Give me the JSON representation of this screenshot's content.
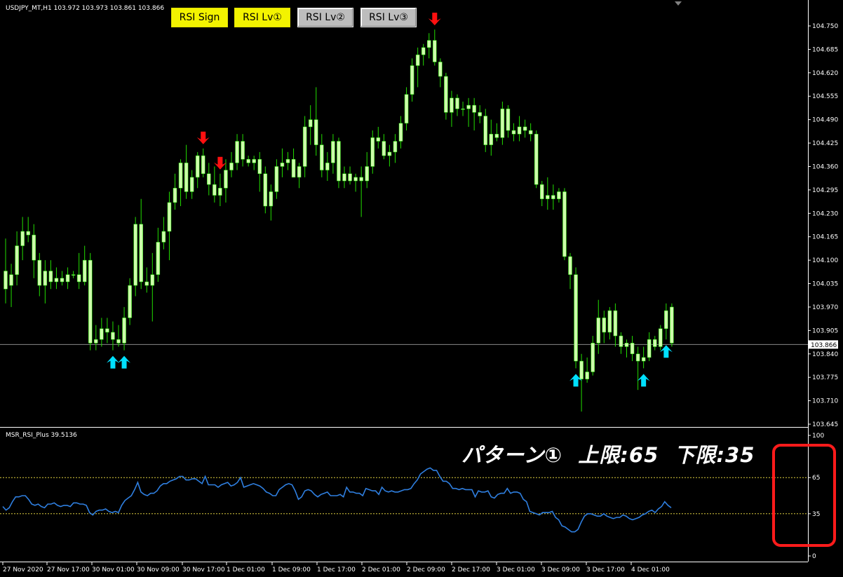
{
  "chart_header": {
    "symbol_line": "USDJPY_MT,H1  103.972 103.973 103.861 103.866"
  },
  "buttons": [
    {
      "label": "RSI Sign",
      "state": "on"
    },
    {
      "label": "RSI Lv①",
      "state": "on"
    },
    {
      "label": "RSI Lv②",
      "state": "off"
    },
    {
      "label": "RSI Lv③",
      "state": "off"
    }
  ],
  "indicator": {
    "label": "MSR_RSI_Plus 39.5136",
    "pattern_title": "パターン①  上限:65  下限:35",
    "upper_level": 65,
    "lower_level": 35
  },
  "price_axis": {
    "ticks": [
      "104.750",
      "104.685",
      "104.620",
      "104.555",
      "104.490",
      "104.425",
      "104.360",
      "104.295",
      "104.230",
      "104.165",
      "104.100",
      "104.035",
      "103.970",
      "103.905",
      "103.840",
      "103.775",
      "103.710",
      "103.645"
    ],
    "current_price": "103.866"
  },
  "rsi_axis": {
    "ticks": [
      "100",
      "65",
      "35",
      "0"
    ]
  },
  "time_axis": {
    "labels": [
      "27 Nov 2020",
      "27 Nov 17:00",
      "30 Nov 01:00",
      "30 Nov 09:00",
      "30 Nov 17:00",
      "1 Dec 01:00",
      "1 Dec 09:00",
      "1 Dec 17:00",
      "2 Dec 01:00",
      "2 Dec 09:00",
      "2 Dec 17:00",
      "3 Dec 01:00",
      "3 Dec 09:00",
      "3 Dec 17:00",
      "4 Dec 01:00"
    ]
  },
  "colors": {
    "background": "#000000",
    "candle_up": "#ccffaa",
    "candle_down": "#ccffaa",
    "wick": "#22dd00",
    "rsi_line": "#2f7fe0",
    "level_line": "#e0d040",
    "buy_arrow": "#00e0ff",
    "sell_arrow": "#ff1010",
    "button_on": "#f3f300",
    "button_off": "#bdbdbd",
    "highlight": "#ff1b1b"
  },
  "chart_data": [
    {
      "type": "candlestick",
      "title": "USDJPY_MT,H1",
      "ylim": [
        103.645,
        104.75
      ],
      "x_labels": [
        "27 Nov 2020",
        "27 Nov 17:00",
        "30 Nov 01:00",
        "30 Nov 09:00",
        "30 Nov 17:00",
        "1 Dec 01:00",
        "1 Dec 09:00",
        "1 Dec 17:00",
        "2 Dec 01:00",
        "2 Dec 09:00",
        "2 Dec 17:00",
        "3 Dec 01:00",
        "3 Dec 09:00",
        "3 Dec 17:00",
        "4 Dec 01:00"
      ],
      "candles": [
        {
          "o": 104.07,
          "h": 104.16,
          "l": 103.98,
          "c": 104.02
        },
        {
          "o": 104.03,
          "h": 104.09,
          "l": 103.97,
          "c": 104.06
        },
        {
          "o": 104.06,
          "h": 104.18,
          "l": 104.03,
          "c": 104.14
        },
        {
          "o": 104.14,
          "h": 104.22,
          "l": 104.1,
          "c": 104.18
        },
        {
          "o": 104.18,
          "h": 104.22,
          "l": 104.15,
          "c": 104.17
        },
        {
          "o": 104.17,
          "h": 104.2,
          "l": 104.05,
          "c": 104.1
        },
        {
          "o": 104.1,
          "h": 104.12,
          "l": 104.0,
          "c": 104.03
        },
        {
          "o": 104.03,
          "h": 104.1,
          "l": 103.98,
          "c": 104.07
        },
        {
          "o": 104.07,
          "h": 104.1,
          "l": 104.02,
          "c": 104.04
        },
        {
          "o": 104.04,
          "h": 104.08,
          "l": 104.02,
          "c": 104.05
        },
        {
          "o": 104.05,
          "h": 104.07,
          "l": 104.03,
          "c": 104.04
        },
        {
          "o": 104.04,
          "h": 104.08,
          "l": 104.02,
          "c": 104.06
        },
        {
          "o": 104.06,
          "h": 104.07,
          "l": 104.05,
          "c": 104.06
        },
        {
          "o": 104.06,
          "h": 104.12,
          "l": 104.02,
          "c": 104.04
        },
        {
          "o": 104.04,
          "h": 104.14,
          "l": 104.03,
          "c": 104.1
        },
        {
          "o": 104.1,
          "h": 104.12,
          "l": 103.85,
          "c": 103.87
        },
        {
          "o": 103.87,
          "h": 103.92,
          "l": 103.85,
          "c": 103.88
        },
        {
          "o": 103.88,
          "h": 103.94,
          "l": 103.86,
          "c": 103.91
        },
        {
          "o": 103.91,
          "h": 103.94,
          "l": 103.87,
          "c": 103.9
        },
        {
          "o": 103.9,
          "h": 103.93,
          "l": 103.85,
          "c": 103.88
        },
        {
          "o": 103.88,
          "h": 103.92,
          "l": 103.86,
          "c": 103.87
        },
        {
          "o": 103.87,
          "h": 103.97,
          "l": 103.85,
          "c": 103.94
        },
        {
          "o": 103.94,
          "h": 104.05,
          "l": 103.92,
          "c": 104.03
        },
        {
          "o": 104.03,
          "h": 104.22,
          "l": 104.0,
          "c": 104.2
        },
        {
          "o": 104.2,
          "h": 104.27,
          "l": 104.02,
          "c": 104.04
        },
        {
          "o": 104.04,
          "h": 104.08,
          "l": 104.01,
          "c": 104.03
        },
        {
          "o": 104.03,
          "h": 104.12,
          "l": 103.93,
          "c": 104.06
        },
        {
          "o": 104.06,
          "h": 104.19,
          "l": 104.04,
          "c": 104.15
        },
        {
          "o": 104.15,
          "h": 104.22,
          "l": 104.13,
          "c": 104.18
        },
        {
          "o": 104.18,
          "h": 104.29,
          "l": 104.1,
          "c": 104.26
        },
        {
          "o": 104.26,
          "h": 104.34,
          "l": 104.24,
          "c": 104.3
        },
        {
          "o": 104.3,
          "h": 104.38,
          "l": 104.25,
          "c": 104.37
        },
        {
          "o": 104.37,
          "h": 104.42,
          "l": 104.27,
          "c": 104.29
        },
        {
          "o": 104.29,
          "h": 104.35,
          "l": 104.27,
          "c": 104.33
        },
        {
          "o": 104.33,
          "h": 104.4,
          "l": 104.3,
          "c": 104.39
        },
        {
          "o": 104.39,
          "h": 104.41,
          "l": 104.33,
          "c": 104.34
        },
        {
          "o": 104.34,
          "h": 104.37,
          "l": 104.28,
          "c": 104.31
        },
        {
          "o": 104.31,
          "h": 104.36,
          "l": 104.26,
          "c": 104.28
        },
        {
          "o": 104.28,
          "h": 104.34,
          "l": 104.25,
          "c": 104.3
        },
        {
          "o": 104.3,
          "h": 104.38,
          "l": 104.26,
          "c": 104.35
        },
        {
          "o": 104.35,
          "h": 104.4,
          "l": 104.33,
          "c": 104.37
        },
        {
          "o": 104.37,
          "h": 104.45,
          "l": 104.35,
          "c": 104.43
        },
        {
          "o": 104.43,
          "h": 104.45,
          "l": 104.36,
          "c": 104.38
        },
        {
          "o": 104.38,
          "h": 104.39,
          "l": 104.36,
          "c": 104.37
        },
        {
          "o": 104.37,
          "h": 104.39,
          "l": 104.35,
          "c": 104.38
        },
        {
          "o": 104.38,
          "h": 104.4,
          "l": 104.29,
          "c": 104.34
        },
        {
          "o": 104.34,
          "h": 104.36,
          "l": 104.23,
          "c": 104.25
        },
        {
          "o": 104.25,
          "h": 104.31,
          "l": 104.21,
          "c": 104.29
        },
        {
          "o": 104.29,
          "h": 104.38,
          "l": 104.27,
          "c": 104.36
        },
        {
          "o": 104.36,
          "h": 104.41,
          "l": 104.33,
          "c": 104.37
        },
        {
          "o": 104.37,
          "h": 104.4,
          "l": 104.35,
          "c": 104.38
        },
        {
          "o": 104.38,
          "h": 104.41,
          "l": 104.33,
          "c": 104.33
        },
        {
          "o": 104.33,
          "h": 104.37,
          "l": 104.3,
          "c": 104.36
        },
        {
          "o": 104.36,
          "h": 104.5,
          "l": 104.33,
          "c": 104.47
        },
        {
          "o": 104.47,
          "h": 104.53,
          "l": 104.42,
          "c": 104.49
        },
        {
          "o": 104.49,
          "h": 104.58,
          "l": 104.39,
          "c": 104.42
        },
        {
          "o": 104.42,
          "h": 104.45,
          "l": 104.33,
          "c": 104.35
        },
        {
          "o": 104.35,
          "h": 104.4,
          "l": 104.32,
          "c": 104.37
        },
        {
          "o": 104.37,
          "h": 104.45,
          "l": 104.34,
          "c": 104.43
        },
        {
          "o": 104.43,
          "h": 104.44,
          "l": 104.3,
          "c": 104.32
        },
        {
          "o": 104.32,
          "h": 104.36,
          "l": 104.3,
          "c": 104.34
        },
        {
          "o": 104.34,
          "h": 104.36,
          "l": 104.31,
          "c": 104.32
        },
        {
          "o": 104.32,
          "h": 104.34,
          "l": 104.29,
          "c": 104.33
        },
        {
          "o": 104.33,
          "h": 104.36,
          "l": 104.22,
          "c": 104.32
        },
        {
          "o": 104.32,
          "h": 104.4,
          "l": 104.3,
          "c": 104.36
        },
        {
          "o": 104.36,
          "h": 104.46,
          "l": 104.34,
          "c": 104.44
        },
        {
          "o": 104.44,
          "h": 104.47,
          "l": 104.41,
          "c": 104.43
        },
        {
          "o": 104.43,
          "h": 104.45,
          "l": 104.38,
          "c": 104.39
        },
        {
          "o": 104.39,
          "h": 104.42,
          "l": 104.36,
          "c": 104.4
        },
        {
          "o": 104.4,
          "h": 104.45,
          "l": 104.37,
          "c": 104.43
        },
        {
          "o": 104.43,
          "h": 104.5,
          "l": 104.41,
          "c": 104.48
        },
        {
          "o": 104.48,
          "h": 104.58,
          "l": 104.46,
          "c": 104.56
        },
        {
          "o": 104.56,
          "h": 104.66,
          "l": 104.54,
          "c": 104.64
        },
        {
          "o": 104.64,
          "h": 104.69,
          "l": 104.58,
          "c": 104.67
        },
        {
          "o": 104.67,
          "h": 104.7,
          "l": 104.64,
          "c": 104.69
        },
        {
          "o": 104.69,
          "h": 104.73,
          "l": 104.66,
          "c": 104.71
        },
        {
          "o": 104.71,
          "h": 104.74,
          "l": 104.64,
          "c": 104.65
        },
        {
          "o": 104.65,
          "h": 104.66,
          "l": 104.58,
          "c": 104.61
        },
        {
          "o": 104.61,
          "h": 104.62,
          "l": 104.49,
          "c": 104.51
        },
        {
          "o": 104.51,
          "h": 104.57,
          "l": 104.47,
          "c": 104.55
        },
        {
          "o": 104.55,
          "h": 104.56,
          "l": 104.5,
          "c": 104.52
        },
        {
          "o": 104.52,
          "h": 104.54,
          "l": 104.5,
          "c": 104.52
        },
        {
          "o": 104.52,
          "h": 104.55,
          "l": 104.47,
          "c": 104.53
        },
        {
          "o": 104.53,
          "h": 104.55,
          "l": 104.46,
          "c": 104.51
        },
        {
          "o": 104.51,
          "h": 104.53,
          "l": 104.48,
          "c": 104.5
        },
        {
          "o": 104.5,
          "h": 104.52,
          "l": 104.4,
          "c": 104.42
        },
        {
          "o": 104.42,
          "h": 104.49,
          "l": 104.39,
          "c": 104.45
        },
        {
          "o": 104.45,
          "h": 104.48,
          "l": 104.43,
          "c": 104.44
        },
        {
          "o": 104.44,
          "h": 104.54,
          "l": 104.42,
          "c": 104.52
        },
        {
          "o": 104.52,
          "h": 104.53,
          "l": 104.44,
          "c": 104.46
        },
        {
          "o": 104.46,
          "h": 104.48,
          "l": 104.43,
          "c": 104.45
        },
        {
          "o": 104.45,
          "h": 104.5,
          "l": 104.43,
          "c": 104.47
        },
        {
          "o": 104.47,
          "h": 104.49,
          "l": 104.44,
          "c": 104.46
        },
        {
          "o": 104.46,
          "h": 104.48,
          "l": 104.43,
          "c": 104.45
        },
        {
          "o": 104.45,
          "h": 104.46,
          "l": 104.3,
          "c": 104.31
        },
        {
          "o": 104.31,
          "h": 104.32,
          "l": 104.25,
          "c": 104.27
        },
        {
          "o": 104.27,
          "h": 104.33,
          "l": 104.24,
          "c": 104.28
        },
        {
          "o": 104.28,
          "h": 104.31,
          "l": 104.24,
          "c": 104.27
        },
        {
          "o": 104.27,
          "h": 104.3,
          "l": 104.26,
          "c": 104.29
        },
        {
          "o": 104.29,
          "h": 104.3,
          "l": 104.1,
          "c": 104.11
        },
        {
          "o": 104.11,
          "h": 104.12,
          "l": 104.02,
          "c": 104.06
        },
        {
          "o": 104.06,
          "h": 104.08,
          "l": 103.8,
          "c": 103.82
        },
        {
          "o": 103.82,
          "h": 103.84,
          "l": 103.68,
          "c": 103.77
        },
        {
          "o": 103.77,
          "h": 103.83,
          "l": 103.76,
          "c": 103.79
        },
        {
          "o": 103.79,
          "h": 103.89,
          "l": 103.78,
          "c": 103.87
        },
        {
          "o": 103.87,
          "h": 103.99,
          "l": 103.84,
          "c": 103.94
        },
        {
          "o": 103.94,
          "h": 103.96,
          "l": 103.87,
          "c": 103.9
        },
        {
          "o": 103.9,
          "h": 103.97,
          "l": 103.88,
          "c": 103.96
        },
        {
          "o": 103.96,
          "h": 103.98,
          "l": 103.86,
          "c": 103.89
        },
        {
          "o": 103.89,
          "h": 103.9,
          "l": 103.84,
          "c": 103.86
        },
        {
          "o": 103.86,
          "h": 103.88,
          "l": 103.83,
          "c": 103.87
        },
        {
          "o": 103.87,
          "h": 103.89,
          "l": 103.82,
          "c": 103.84
        },
        {
          "o": 103.84,
          "h": 103.86,
          "l": 103.74,
          "c": 103.82
        },
        {
          "o": 103.82,
          "h": 103.86,
          "l": 103.8,
          "c": 103.83
        },
        {
          "o": 103.83,
          "h": 103.9,
          "l": 103.82,
          "c": 103.88
        },
        {
          "o": 103.88,
          "h": 103.89,
          "l": 103.85,
          "c": 103.86
        },
        {
          "o": 103.86,
          "h": 103.92,
          "l": 103.85,
          "c": 103.91
        },
        {
          "o": 103.91,
          "h": 103.98,
          "l": 103.88,
          "c": 103.96
        },
        {
          "o": 103.97,
          "h": 103.98,
          "l": 103.86,
          "c": 103.87
        }
      ],
      "buy_signals": [
        19,
        21,
        101,
        113,
        117
      ],
      "sell_signals": [
        35,
        38,
        76
      ]
    },
    {
      "type": "line",
      "title": "MSR_RSI_Plus 39.5136",
      "ylim": [
        0,
        100
      ],
      "levels": [
        65,
        35
      ],
      "series": [
        {
          "name": "MSR_RSI_Plus",
          "values": [
            41,
            38,
            40,
            45,
            49,
            49,
            50,
            50,
            47,
            43,
            42,
            43,
            41,
            40,
            43,
            43,
            44,
            42,
            41,
            42,
            42,
            41,
            44,
            44,
            43,
            43,
            42,
            36,
            34,
            37,
            38,
            38,
            39,
            37,
            36,
            37,
            36,
            42,
            46,
            48,
            50,
            55,
            61,
            53,
            51,
            50,
            52,
            52,
            54,
            58,
            60,
            60,
            62,
            63,
            64,
            66,
            66,
            63,
            63,
            64,
            64,
            62,
            60,
            66,
            59,
            59,
            59,
            57,
            59,
            60,
            61,
            58,
            59,
            61,
            65,
            57,
            58,
            59,
            60,
            59,
            58,
            56,
            53,
            52,
            50,
            50,
            55,
            57,
            59,
            60,
            59,
            54,
            47,
            49,
            54,
            55,
            54,
            51,
            49,
            51,
            52,
            53,
            50,
            50,
            50,
            51,
            49,
            57,
            53,
            53,
            52,
            52,
            50,
            56,
            55,
            54,
            54,
            51,
            57,
            54,
            53,
            54,
            53,
            53,
            54,
            55,
            55,
            56,
            60,
            63,
            68,
            70,
            72,
            73,
            71,
            71,
            66,
            62,
            62,
            60,
            56,
            56,
            55,
            56,
            55,
            55,
            55,
            49,
            54,
            53,
            53,
            54,
            49,
            48,
            51,
            52,
            52,
            56,
            52,
            53,
            53,
            52,
            47,
            45,
            37,
            36,
            35,
            34,
            36,
            36,
            36,
            37,
            32,
            30,
            25,
            24,
            22,
            20,
            20,
            22,
            28,
            33,
            35,
            35,
            34,
            33,
            33,
            35,
            33,
            32,
            31,
            32,
            32,
            34,
            33,
            31,
            30,
            31,
            32,
            34,
            35,
            37,
            38,
            36,
            39,
            41,
            45,
            42,
            40
          ]
        }
      ]
    }
  ]
}
